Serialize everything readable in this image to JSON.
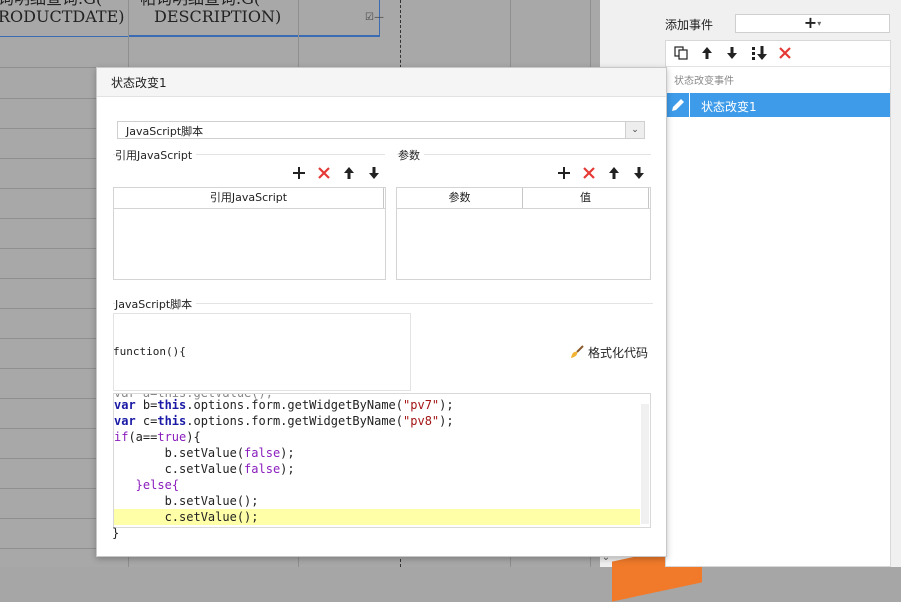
{
  "sheet": {
    "header_line1_a": "询明细查询.G(",
    "header_line2_a": "RODUCTDATE)",
    "header_line1_b": "帕询明细查询.G(",
    "header_line2_b": "DESCRIPTION)",
    "header_mark": "☑—"
  },
  "dialog": {
    "title": "状态改变1",
    "type_value": "JavaScript脚本",
    "ref_js_group": "引用JavaScript",
    "ref_js_column": "引用JavaScript",
    "params_group": "参数",
    "params_columns": [
      "参数",
      "值"
    ],
    "script_group": "JavaScript脚本",
    "function_header": "function(){",
    "format_label": "格式化代码",
    "close_brace": "}",
    "code": {
      "l0": "var a=this.getValue();",
      "l1": [
        "var ",
        "b=",
        "this",
        ".options.form.getWidgetByName(",
        "\"pv7\"",
        ");"
      ],
      "l2": [
        "var ",
        "c=",
        "this",
        ".options.form.getWidgetByName(",
        "\"pv8\"",
        ");"
      ],
      "l3": [
        "if",
        "(a==",
        "true",
        "){"
      ],
      "l4": [
        "       b.setValue(",
        "false",
        ");"
      ],
      "l5": [
        "       c.setValue(",
        "false",
        ");"
      ],
      "l6": [
        "   }",
        "else",
        "{"
      ],
      "l7": "       b.setValue();",
      "l8": "       c.setValue();"
    }
  },
  "right_panel": {
    "add_event_label": "添加事件",
    "add_event_button": "+",
    "add_event_caret": "▾",
    "event_category": "状态改变事件",
    "event_item": "状态改变1"
  },
  "icons": {
    "add": "+",
    "delete": "✕",
    "up": "🡑",
    "down": "🡓"
  }
}
